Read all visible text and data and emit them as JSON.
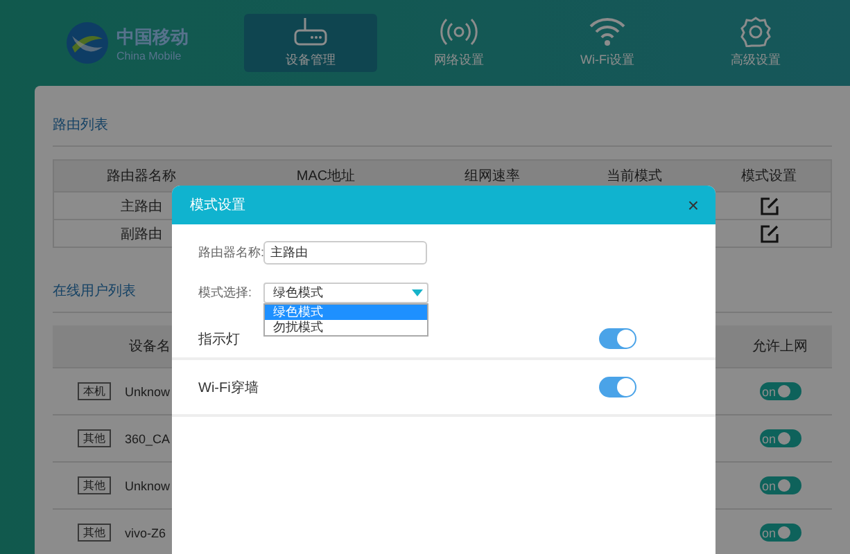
{
  "logo": {
    "name": "中国移动",
    "subtitle": "China Mobile"
  },
  "nav_tabs": [
    {
      "label": "设备管理",
      "kind": "router",
      "selected": true
    },
    {
      "label": "网络设置",
      "kind": "signal",
      "selected": false
    },
    {
      "label": "Wi-Fi设置",
      "kind": "wifi",
      "selected": false
    },
    {
      "label": "高级设置",
      "kind": "gear",
      "selected": false
    }
  ],
  "router_list": {
    "title": "路由列表",
    "columns": [
      "路由器名称",
      "MAC地址",
      "组网速率",
      "当前模式",
      "模式设置"
    ],
    "rows": [
      {
        "name": "主路由"
      },
      {
        "name": "副路由"
      }
    ]
  },
  "online_users": {
    "title": "在线用户列表",
    "columns": [
      "设备名",
      "允许上网"
    ],
    "rows": [
      {
        "tag": "本机",
        "name": "Unknow",
        "allowed": true,
        "switch_label": "on"
      },
      {
        "tag": "其他",
        "name": "360_CA",
        "allowed": true,
        "switch_label": "on"
      },
      {
        "tag": "其他",
        "name": "Unknow",
        "allowed": true,
        "switch_label": "on"
      },
      {
        "tag": "其他",
        "name": "vivo-Z6",
        "allowed": true,
        "switch_label": "on"
      }
    ]
  },
  "dialog": {
    "title": "模式设置",
    "close": "×",
    "name_field": {
      "label": "路由器名称:",
      "value": "主路由"
    },
    "mode_select": {
      "label": "模式选择:",
      "value": "绿色模式",
      "expanded": true,
      "options": [
        {
          "label": "绿色模式",
          "selected": true
        },
        {
          "label": "勿扰模式",
          "selected": false
        }
      ]
    },
    "switches": [
      {
        "label": "指示灯",
        "on": true
      },
      {
        "label": "Wi-Fi穿墙",
        "on": true
      }
    ]
  }
}
